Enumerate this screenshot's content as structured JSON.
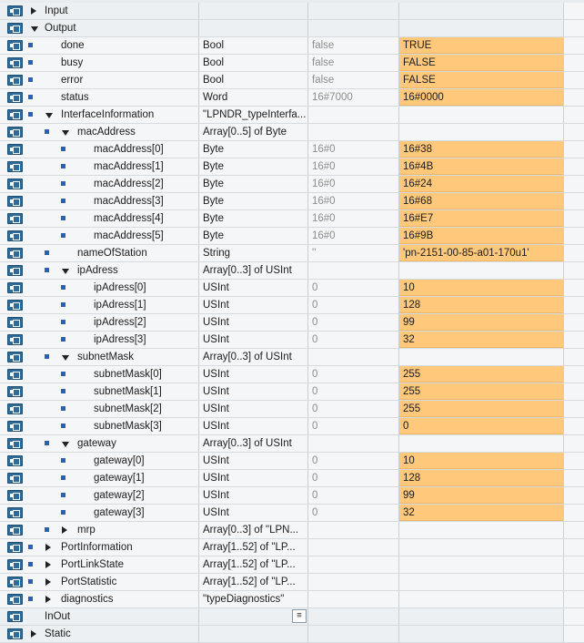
{
  "rows": [
    {
      "level": 0,
      "label": "Input",
      "expander": "collapsed",
      "bullet": false,
      "type": "",
      "start": "",
      "monitor": "",
      "hl": false
    },
    {
      "level": 0,
      "label": "Output",
      "expander": "expanded",
      "bullet": false,
      "type": "",
      "start": "",
      "monitor": "",
      "hl": false
    },
    {
      "level": 1,
      "label": "done",
      "expander": "none",
      "bullet": true,
      "type": "Bool",
      "start": "false",
      "monitor": "TRUE",
      "hl": true
    },
    {
      "level": 1,
      "label": "busy",
      "expander": "none",
      "bullet": true,
      "type": "Bool",
      "start": "false",
      "monitor": "FALSE",
      "hl": true
    },
    {
      "level": 1,
      "label": "error",
      "expander": "none",
      "bullet": true,
      "type": "Bool",
      "start": "false",
      "monitor": "FALSE",
      "hl": true
    },
    {
      "level": 1,
      "label": "status",
      "expander": "none",
      "bullet": true,
      "type": "Word",
      "start": "16#7000",
      "monitor": "16#0000",
      "hl": true
    },
    {
      "level": 1,
      "label": "InterfaceInformation",
      "expander": "expanded",
      "bullet": true,
      "type": "\"LPNDR_typeInterfa...",
      "start": "",
      "monitor": "",
      "hl": false
    },
    {
      "level": 2,
      "label": "macAddress",
      "expander": "expanded",
      "bullet": true,
      "type": "Array[0..5] of Byte",
      "start": "",
      "monitor": "",
      "hl": false
    },
    {
      "level": 3,
      "label": "macAddress[0]",
      "expander": "none",
      "bullet": true,
      "type": "Byte",
      "start": "16#0",
      "monitor": "16#38",
      "hl": true
    },
    {
      "level": 3,
      "label": "macAddress[1]",
      "expander": "none",
      "bullet": true,
      "type": "Byte",
      "start": "16#0",
      "monitor": "16#4B",
      "hl": true
    },
    {
      "level": 3,
      "label": "macAddress[2]",
      "expander": "none",
      "bullet": true,
      "type": "Byte",
      "start": "16#0",
      "monitor": "16#24",
      "hl": true
    },
    {
      "level": 3,
      "label": "macAddress[3]",
      "expander": "none",
      "bullet": true,
      "type": "Byte",
      "start": "16#0",
      "monitor": "16#68",
      "hl": true
    },
    {
      "level": 3,
      "label": "macAddress[4]",
      "expander": "none",
      "bullet": true,
      "type": "Byte",
      "start": "16#0",
      "monitor": "16#E7",
      "hl": true
    },
    {
      "level": 3,
      "label": "macAddress[5]",
      "expander": "none",
      "bullet": true,
      "type": "Byte",
      "start": "16#0",
      "monitor": "16#9B",
      "hl": true
    },
    {
      "level": 2,
      "label": "nameOfStation",
      "expander": "none",
      "bullet": true,
      "type": "String",
      "start": "''",
      "monitor": "'pn-2151-00-85-a01-170u1'",
      "hl": true
    },
    {
      "level": 2,
      "label": "ipAdress",
      "expander": "expanded",
      "bullet": true,
      "type": "Array[0..3] of USInt",
      "start": "",
      "monitor": "",
      "hl": false
    },
    {
      "level": 3,
      "label": "ipAdress[0]",
      "expander": "none",
      "bullet": true,
      "type": "USInt",
      "start": "0",
      "monitor": "10",
      "hl": true
    },
    {
      "level": 3,
      "label": "ipAdress[1]",
      "expander": "none",
      "bullet": true,
      "type": "USInt",
      "start": "0",
      "monitor": "128",
      "hl": true
    },
    {
      "level": 3,
      "label": "ipAdress[2]",
      "expander": "none",
      "bullet": true,
      "type": "USInt",
      "start": "0",
      "monitor": "99",
      "hl": true
    },
    {
      "level": 3,
      "label": "ipAdress[3]",
      "expander": "none",
      "bullet": true,
      "type": "USInt",
      "start": "0",
      "monitor": "32",
      "hl": true
    },
    {
      "level": 2,
      "label": "subnetMask",
      "expander": "expanded",
      "bullet": true,
      "type": "Array[0..3] of USInt",
      "start": "",
      "monitor": "",
      "hl": false
    },
    {
      "level": 3,
      "label": "subnetMask[0]",
      "expander": "none",
      "bullet": true,
      "type": "USInt",
      "start": "0",
      "monitor": "255",
      "hl": true
    },
    {
      "level": 3,
      "label": "subnetMask[1]",
      "expander": "none",
      "bullet": true,
      "type": "USInt",
      "start": "0",
      "monitor": "255",
      "hl": true
    },
    {
      "level": 3,
      "label": "subnetMask[2]",
      "expander": "none",
      "bullet": true,
      "type": "USInt",
      "start": "0",
      "monitor": "255",
      "hl": true
    },
    {
      "level": 3,
      "label": "subnetMask[3]",
      "expander": "none",
      "bullet": true,
      "type": "USInt",
      "start": "0",
      "monitor": "0",
      "hl": true
    },
    {
      "level": 2,
      "label": "gateway",
      "expander": "expanded",
      "bullet": true,
      "type": "Array[0..3] of USInt",
      "start": "",
      "monitor": "",
      "hl": false
    },
    {
      "level": 3,
      "label": "gateway[0]",
      "expander": "none",
      "bullet": true,
      "type": "USInt",
      "start": "0",
      "monitor": "10",
      "hl": true
    },
    {
      "level": 3,
      "label": "gateway[1]",
      "expander": "none",
      "bullet": true,
      "type": "USInt",
      "start": "0",
      "monitor": "128",
      "hl": true
    },
    {
      "level": 3,
      "label": "gateway[2]",
      "expander": "none",
      "bullet": true,
      "type": "USInt",
      "start": "0",
      "monitor": "99",
      "hl": true
    },
    {
      "level": 3,
      "label": "gateway[3]",
      "expander": "none",
      "bullet": true,
      "type": "USInt",
      "start": "0",
      "monitor": "32",
      "hl": true
    },
    {
      "level": 2,
      "label": "mrp",
      "expander": "collapsed",
      "bullet": true,
      "type": "Array[0..3] of \"LPN...",
      "start": "",
      "monitor": "",
      "hl": false
    },
    {
      "level": 1,
      "label": "PortInformation",
      "expander": "collapsed",
      "bullet": true,
      "type": "Array[1..52] of \"LP...",
      "start": "",
      "monitor": "",
      "hl": false
    },
    {
      "level": 1,
      "label": "PortLinkState",
      "expander": "collapsed",
      "bullet": true,
      "type": "Array[1..52] of \"LP...",
      "start": "",
      "monitor": "",
      "hl": false
    },
    {
      "level": 1,
      "label": "PortStatistic",
      "expander": "collapsed",
      "bullet": true,
      "type": "Array[1..52] of \"LP...",
      "start": "",
      "monitor": "",
      "hl": false
    },
    {
      "level": 1,
      "label": "diagnostics",
      "expander": "collapsed",
      "bullet": true,
      "type": "\"typeDiagnostics\"",
      "start": "",
      "monitor": "",
      "hl": false
    },
    {
      "level": 0,
      "label": "InOut",
      "expander": "none",
      "bullet": false,
      "type": "",
      "start": "",
      "monitor": "",
      "hl": false,
      "listButton": true
    },
    {
      "level": 0,
      "label": "Static",
      "expander": "collapsed",
      "bullet": false,
      "type": "",
      "start": "",
      "monitor": "",
      "hl": false
    }
  ],
  "colors": {
    "highlight": "#ffc87a",
    "bullet": "#2d5fb5",
    "icon": "#2e6b98"
  }
}
